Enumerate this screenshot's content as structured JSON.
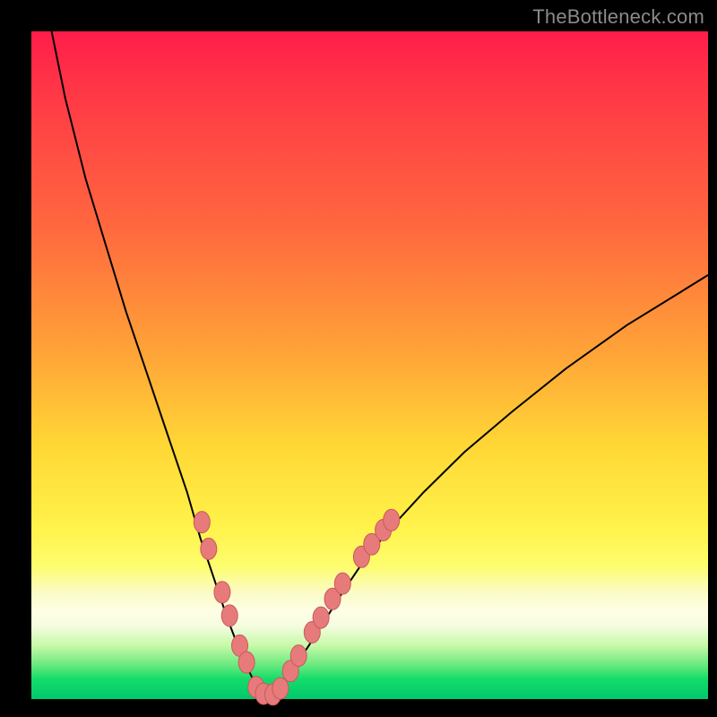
{
  "watermark": {
    "text": "TheBottleneck.com"
  },
  "colors": {
    "background": "#000000",
    "curve_stroke": "#000000",
    "dot_fill": "#e77b7b",
    "dot_stroke": "#c85a5a"
  },
  "chart_data": {
    "type": "line",
    "title": "",
    "xlabel": "",
    "ylabel": "",
    "xlim": [
      0,
      100
    ],
    "ylim": [
      0,
      100
    ],
    "series": [
      {
        "name": "left-curve",
        "x": [
          3,
          5,
          8,
          11,
          14,
          17,
          20,
          23,
          25,
          27,
          29,
          30.5,
          32,
          33,
          34,
          35
        ],
        "y": [
          100,
          90,
          78,
          68,
          58,
          49,
          40,
          31,
          24,
          18,
          12,
          8,
          4.5,
          2.5,
          1.2,
          0.5
        ],
        "note": "descending branch, percentage-like units"
      },
      {
        "name": "right-curve",
        "x": [
          35,
          36,
          37.5,
          39,
          41,
          43.5,
          46,
          49,
          53,
          58,
          64,
          71,
          79,
          88,
          96,
          100
        ],
        "y": [
          0.5,
          1.2,
          2.8,
          5,
          8,
          12,
          16,
          20.5,
          25.5,
          31,
          37,
          43,
          49.5,
          56,
          61,
          63.5
        ],
        "note": "ascending branch, percentage-like units"
      }
    ],
    "markers": [
      {
        "name": "left-dot-1",
        "x": 25.2,
        "y": 26.5
      },
      {
        "name": "left-dot-2",
        "x": 26.2,
        "y": 22.5
      },
      {
        "name": "left-dot-3",
        "x": 28.2,
        "y": 16.0
      },
      {
        "name": "left-dot-4",
        "x": 29.3,
        "y": 12.5
      },
      {
        "name": "left-dot-5",
        "x": 30.8,
        "y": 8.0
      },
      {
        "name": "left-dot-6",
        "x": 31.8,
        "y": 5.5
      },
      {
        "name": "bottom-dot-1",
        "x": 33.2,
        "y": 1.8
      },
      {
        "name": "bottom-dot-2",
        "x": 34.3,
        "y": 0.8
      },
      {
        "name": "bottom-dot-3",
        "x": 35.7,
        "y": 0.7
      },
      {
        "name": "bottom-dot-4",
        "x": 36.8,
        "y": 1.6
      },
      {
        "name": "right-dot-1",
        "x": 38.3,
        "y": 4.2
      },
      {
        "name": "right-dot-2",
        "x": 39.5,
        "y": 6.5
      },
      {
        "name": "right-dot-3",
        "x": 41.5,
        "y": 10.0
      },
      {
        "name": "right-dot-4",
        "x": 42.8,
        "y": 12.2
      },
      {
        "name": "right-dot-5",
        "x": 44.5,
        "y": 15.0
      },
      {
        "name": "right-dot-6",
        "x": 46.0,
        "y": 17.3
      },
      {
        "name": "right-dot-7",
        "x": 48.8,
        "y": 21.3
      },
      {
        "name": "right-dot-8",
        "x": 50.3,
        "y": 23.2
      },
      {
        "name": "right-dot-9",
        "x": 52.0,
        "y": 25.3
      },
      {
        "name": "right-dot-10",
        "x": 53.2,
        "y": 26.8
      }
    ]
  }
}
